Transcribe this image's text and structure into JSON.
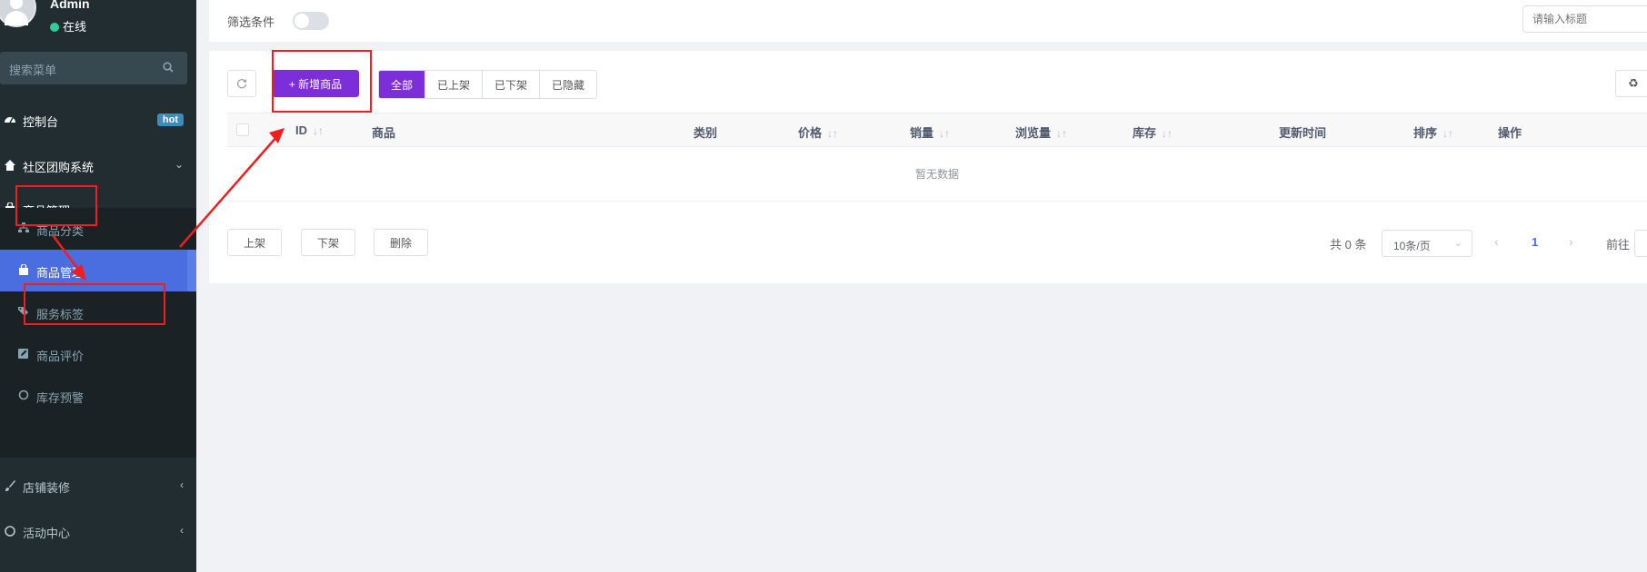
{
  "user": {
    "name": "Admin",
    "status": "在线"
  },
  "sidebar": {
    "search_placeholder": "搜索菜单",
    "items": [
      {
        "label": "控制台",
        "badge": "hot",
        "icon": "dashboard-icon"
      },
      {
        "label": "社区团购系统",
        "icon": "home-icon"
      },
      {
        "label": "商品管理",
        "icon": "shopping-bag-icon"
      },
      {
        "label": "店铺装修",
        "icon": "brush-icon"
      },
      {
        "label": "活动中心",
        "icon": "circle-icon"
      }
    ],
    "subitems": [
      {
        "label": "商品分类",
        "icon": "sitemap-icon"
      },
      {
        "label": "商品管理",
        "icon": "shopping-bag-icon"
      },
      {
        "label": "服务标签",
        "icon": "tags-icon"
      },
      {
        "label": "商品评价",
        "icon": "edit-icon"
      },
      {
        "label": "库存预警",
        "icon": "circle-icon"
      }
    ]
  },
  "filter": {
    "label": "筛选条件",
    "title_placeholder": "请输入标题"
  },
  "toolbar": {
    "add_label": "+ 新增商品",
    "tabs": [
      "全部",
      "已上架",
      "已下架",
      "已隐藏"
    ],
    "active_tab": "全部"
  },
  "table": {
    "columns": [
      "ID",
      "商品",
      "类别",
      "价格",
      "销量",
      "浏览量",
      "库存",
      "更新时间",
      "排序",
      "操作"
    ],
    "empty_text": "暂无数据"
  },
  "actions": {
    "on_shelf": "上架",
    "off_shelf": "下架",
    "delete": "删除"
  },
  "pagination": {
    "total_text": "共 0 条",
    "page_size": "10条/页",
    "current_page": "1",
    "goto_label": "前往"
  },
  "colors": {
    "accent": "#7c2fd8",
    "sidebar_bg": "#222d32",
    "active_menu": "#4a6ee0",
    "annotation": "#f01e1e"
  }
}
